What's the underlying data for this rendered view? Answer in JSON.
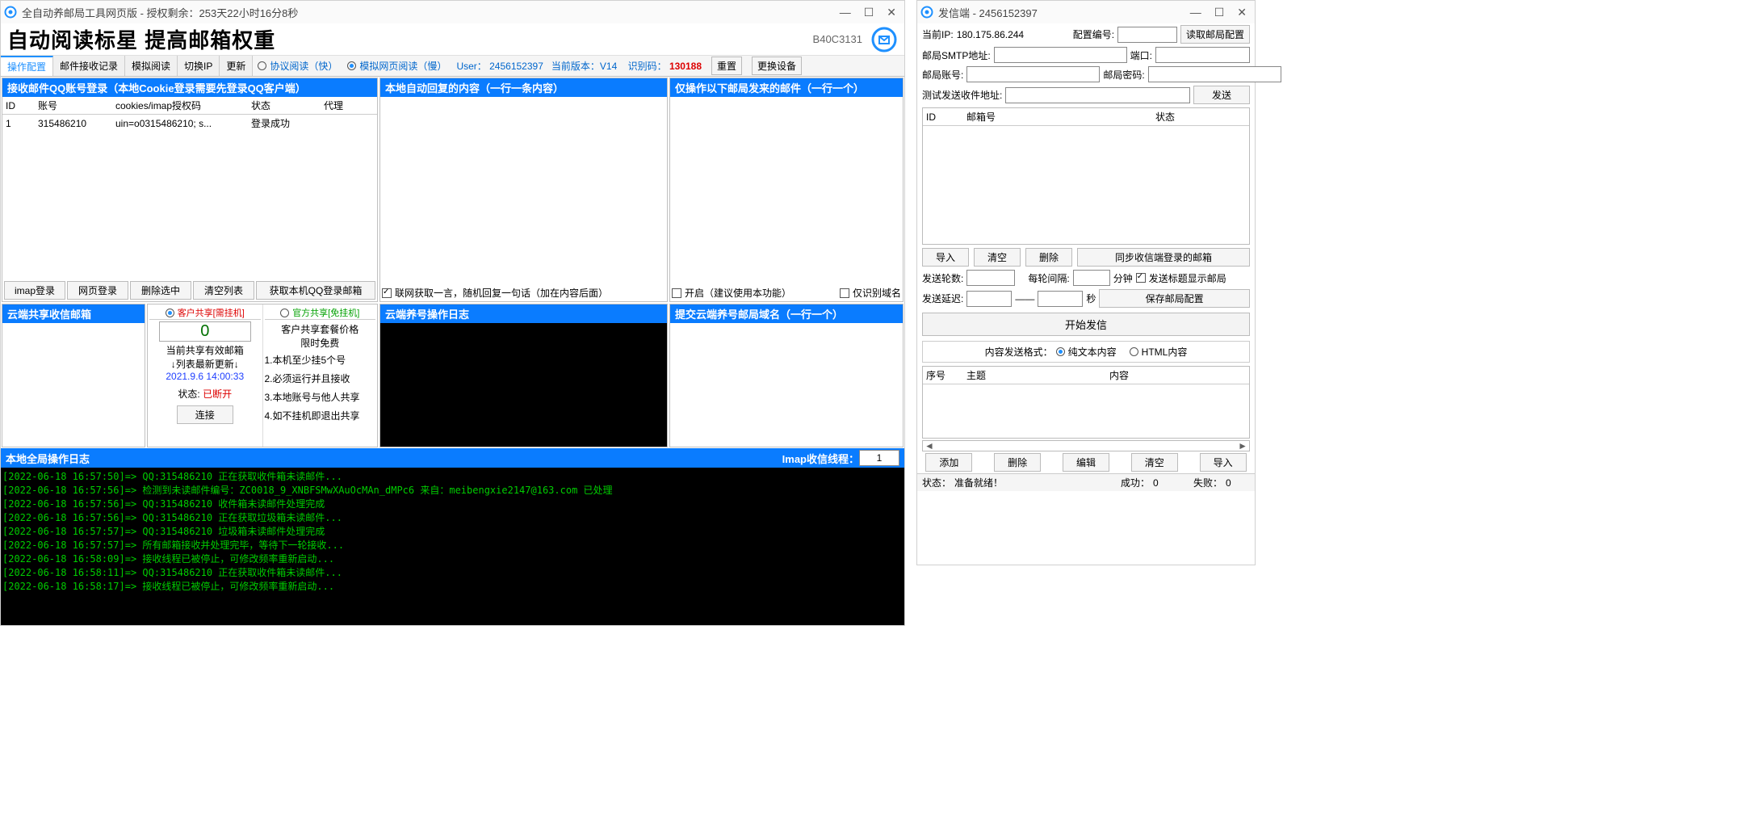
{
  "left": {
    "title": "全自动养邮局工具网页版 - 授权剩余：253天22小时16分8秒",
    "banner_title": "自动阅读标星 提高邮箱权重",
    "banner_code": "B40C3131",
    "tabs": [
      "操作配置",
      "邮件接收记录",
      "模拟阅读",
      "切换IP",
      "更新"
    ],
    "radio_proto": "协议阅读（快）",
    "radio_web": "模拟网页阅读（慢）",
    "user_label": "User：",
    "user_value": "2456152397",
    "version_label": "当前版本：V14",
    "idcode_label": "识别码：",
    "idcode_value": "130188",
    "btn_reset": "重置",
    "btn_device": "更换设备",
    "panel_recv_hdr": "接收邮件QQ账号登录（本地Cookie登录需要先登录QQ客户端）",
    "recv_cols": [
      "ID",
      "账号",
      "cookies/imap授权码",
      "状态",
      "代理"
    ],
    "recv_rows": [
      {
        "id": "1",
        "acc": "315486210",
        "cookie": "uin=o0315486210; s...",
        "status": "登录成功",
        "proxy": ""
      }
    ],
    "btn_imap": "imap登录",
    "btn_web": "网页登录",
    "btn_delsel": "删除选中",
    "btn_clear": "清空列表",
    "btn_getlocal": "获取本机QQ登录邮箱",
    "panel_reply_hdr": "本地自动回复的内容（一行一条内容）",
    "chk_fetch": "联网获取一言，随机回复一句话（加在内容后面）",
    "panel_only_hdr": "仅操作以下邮局发来的邮件（一行一个）",
    "chk_open": "开启（建议使用本功能）",
    "chk_onlydom": "仅识别域名",
    "panel_cloud_hdr": "云端共享收信邮箱",
    "radio_kehu": "客户共享[需挂机]",
    "radio_guan": "官方共享[免挂机]",
    "share_count": "0",
    "share_label": "当前共享有效邮箱",
    "share_refresh": "↓列表最新更新↓",
    "share_time": "2021.9.6 14:00:33",
    "share_status_lbl": "状态:",
    "share_status_val": "已断开",
    "btn_connect": "连接",
    "share_price_title": "客户共享套餐价格",
    "share_price_sub": "限时免费",
    "share_rules": [
      "1.本机至少挂5个号",
      "2.必须运行并且接收",
      "3.本地账号与他人共享",
      "4.如不挂机即退出共享"
    ],
    "panel_cloud_log_hdr": "云端养号操作日志",
    "panel_submit_hdr": "提交云端养号邮局域名（一行一个）",
    "panel_thread_pre": "本地全局操作日志",
    "panel_thread_lbl": "Imap收信线程：",
    "panel_thread_val": "1",
    "loglines": [
      "[2022-06-18 16:57:50]=> QQ:315486210 正在获取收件箱未读邮件...",
      "[2022-06-18 16:57:56]=> 检测到未读邮件编号：ZC0018_9_XNBFSMwXAuOcMAn_dMPc6 来自：meibengxie2147@163.com 已处理",
      "[2022-06-18 16:57:56]=> QQ:315486210 收件箱未读邮件处理完成",
      "[2022-06-18 16:57:56]=> QQ:315486210 正在获取垃圾箱未读邮件...",
      "[2022-06-18 16:57:57]=> QQ:315486210 垃圾箱未读邮件处理完成",
      "[2022-06-18 16:57:57]=> 所有邮箱接收并处理完毕，等待下一轮接收...",
      "[2022-06-18 16:58:09]=> 接收线程已被停止，可修改频率重新启动...",
      "[2022-06-18 16:58:11]=> QQ:315486210 正在获取收件箱未读邮件...",
      "[2022-06-18 16:58:17]=> 接收线程已被停止，可修改频率重新启动..."
    ]
  },
  "right": {
    "title": "发信端 - 2456152397",
    "ip_label": "当前IP:",
    "ip_value": "180.175.86.244",
    "cfg_label": "配置编号:",
    "btn_readcfg": "读取邮局配置",
    "smtp_label": "邮局SMTP地址:",
    "port_label": "端口:",
    "acc_label": "邮局账号:",
    "pwd_label": "邮局密码:",
    "test_label": "测试发送收件地址:",
    "btn_send": "发送",
    "tbl_cols": [
      "ID",
      "邮箱号",
      "状态"
    ],
    "btn_import": "导入",
    "btn_clear2": "清空",
    "btn_del": "删除",
    "btn_sync": "同步收信端登录的邮箱",
    "round_label": "发送轮数:",
    "interval_label": "每轮间隔:",
    "interval_unit": "分钟",
    "chk_showtitle": "发送标题显示邮局",
    "delay_label": "发送延迟:",
    "delay_sep": "——",
    "delay_unit": "秒",
    "btn_savecfg": "保存邮局配置",
    "btn_startsend": "开始发信",
    "fmt_label": "内容发送格式：",
    "radio_plain": "纯文本内容",
    "radio_html": "HTML内容",
    "content_cols": [
      "序号",
      "主题",
      "内容"
    ],
    "btn_add": "添加",
    "btn_del2": "删除",
    "btn_edit": "编辑",
    "btn_clear3": "清空",
    "btn_import2": "导入",
    "status_label": "状态：",
    "status_value": "准备就绪！",
    "succ_label": "成功：",
    "succ_value": "0",
    "fail_label": "失败：",
    "fail_value": "0"
  }
}
